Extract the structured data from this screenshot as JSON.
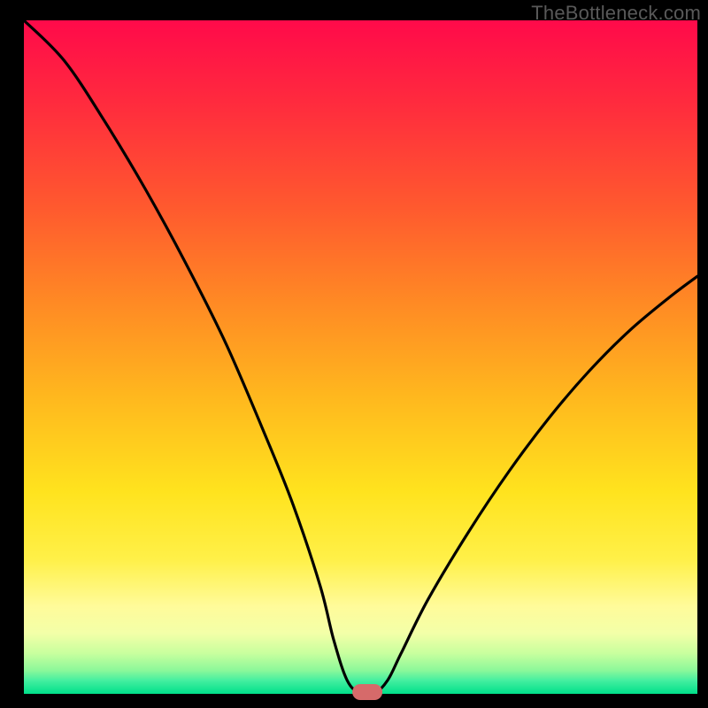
{
  "watermark": "TheBottleneck.com",
  "marker": {
    "color": "#d66a6a"
  },
  "chart_data": {
    "type": "line",
    "title": "",
    "xlabel": "",
    "ylabel": "",
    "xlim": [
      0,
      100
    ],
    "ylim": [
      0,
      100
    ],
    "x": [
      0,
      6,
      12,
      18,
      24,
      30,
      36,
      40,
      44,
      46,
      48,
      50,
      52,
      54,
      56,
      60,
      66,
      72,
      78,
      84,
      90,
      96,
      100
    ],
    "values": [
      100,
      94,
      85,
      75,
      64,
      52,
      38,
      28,
      16,
      8,
      2,
      0,
      0,
      2,
      6,
      14,
      24,
      33,
      41,
      48,
      54,
      59,
      62
    ],
    "marker_x": 51,
    "marker_y": 0
  }
}
